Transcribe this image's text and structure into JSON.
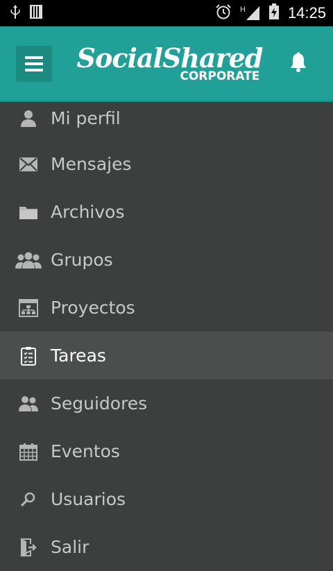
{
  "status": {
    "time": "14:25",
    "network": "H"
  },
  "header": {
    "logo_main": "SocialShared",
    "logo_sub": "CORPORATE"
  },
  "colors": {
    "header_bg": "#21a097",
    "menu_bg": "#3d3f3f",
    "active_bg": "#4c4e4e",
    "icon": "#b5b5b5"
  },
  "menu": {
    "items": [
      {
        "label": "Mi perfil",
        "icon": "user-icon"
      },
      {
        "label": "Mensajes",
        "icon": "envelope-icon"
      },
      {
        "label": "Archivos",
        "icon": "folder-icon"
      },
      {
        "label": "Grupos",
        "icon": "group-icon"
      },
      {
        "label": "Proyectos",
        "icon": "project-icon"
      },
      {
        "label": "Tareas",
        "icon": "clipboard-icon",
        "active": true
      },
      {
        "label": "Seguidores",
        "icon": "followers-icon"
      },
      {
        "label": "Eventos",
        "icon": "calendar-icon"
      },
      {
        "label": "Usuarios",
        "icon": "search-icon"
      },
      {
        "label": "Salir",
        "icon": "exit-icon"
      }
    ]
  }
}
